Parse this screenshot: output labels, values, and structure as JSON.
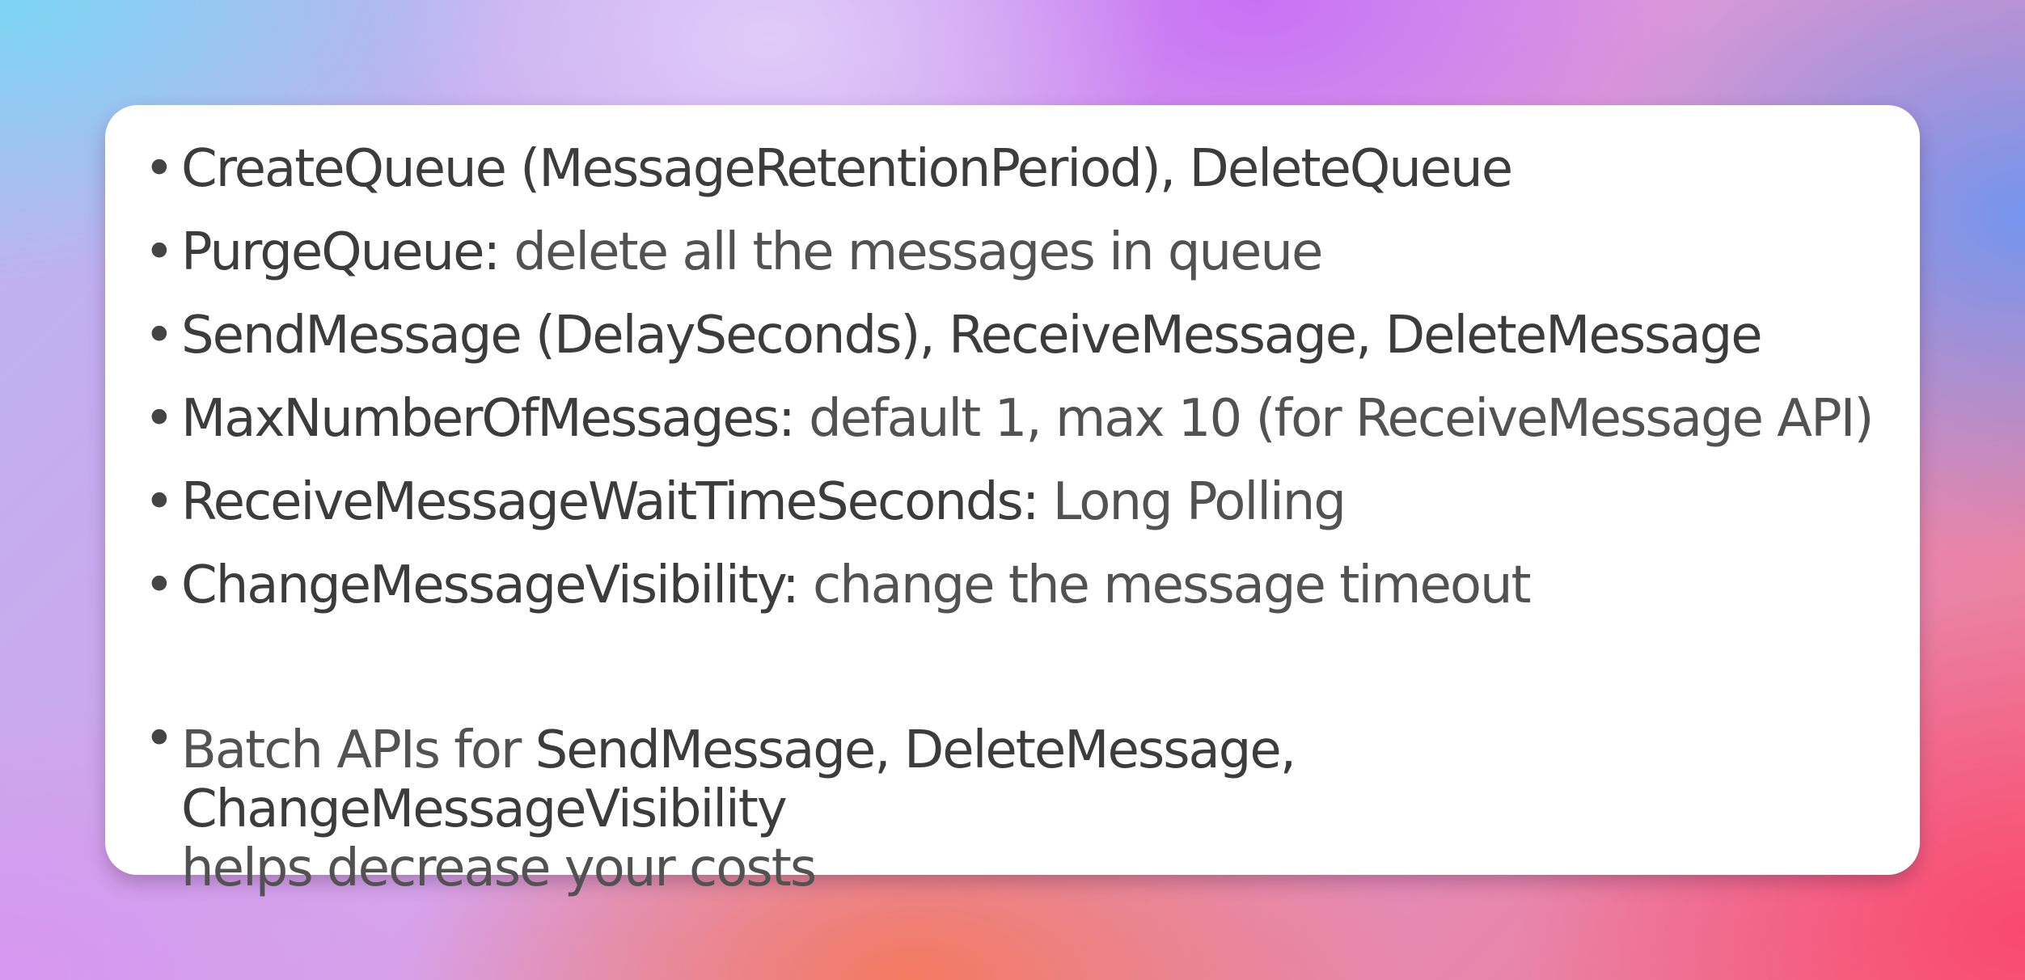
{
  "items": [
    {
      "term": "CreateQueue (MessageRetentionPeriod), DeleteQueue",
      "desc": ""
    },
    {
      "term": "PurgeQueue:",
      "desc": " delete all the messages in queue"
    },
    {
      "term": "SendMessage (DelaySeconds), ReceiveMessage, DeleteMessage",
      "desc": ""
    },
    {
      "term": "MaxNumberOfMessages:",
      "desc": " default 1, max 10 (for ReceiveMessage API)"
    },
    {
      "term": "ReceiveMessageWaitTimeSeconds:",
      "desc": " Long Polling"
    },
    {
      "term": "ChangeMessageVisibility:",
      "desc": " change the message timeout"
    }
  ],
  "batch": {
    "prefix": "Batch APIs for ",
    "term": "SendMessage, DeleteMessage, ChangeMessageVisibility",
    "suffix": "helps decrease your costs"
  }
}
